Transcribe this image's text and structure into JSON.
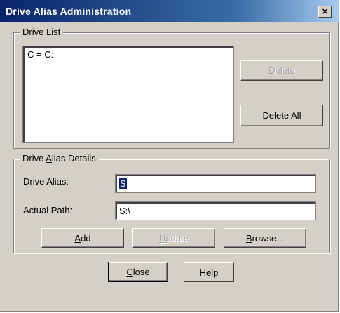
{
  "window": {
    "title": "Drive Alias Administration",
    "close_glyph": "×",
    "close_icon": "close-icon"
  },
  "drive_list": {
    "title": "Drive List",
    "items": [
      "C = C:"
    ],
    "delete_label": "Delete",
    "delete_all_label": "Delete All"
  },
  "details": {
    "title": "Drive Alias Details",
    "alias_label": "Drive Alias:",
    "alias_value": "S",
    "path_label": "Actual Path:",
    "path_value": "S:\\"
  },
  "actions": {
    "add_label": "Add",
    "update_label": "Update",
    "browse_label": "Browse..."
  },
  "footer": {
    "close_label": "Close",
    "help_label": "Help"
  },
  "colors": {
    "title_bar_start": "#0a246a",
    "title_bar_end": "#a6caf0",
    "dialog_face": "#d4d0c8",
    "selection": "#0a246a"
  }
}
